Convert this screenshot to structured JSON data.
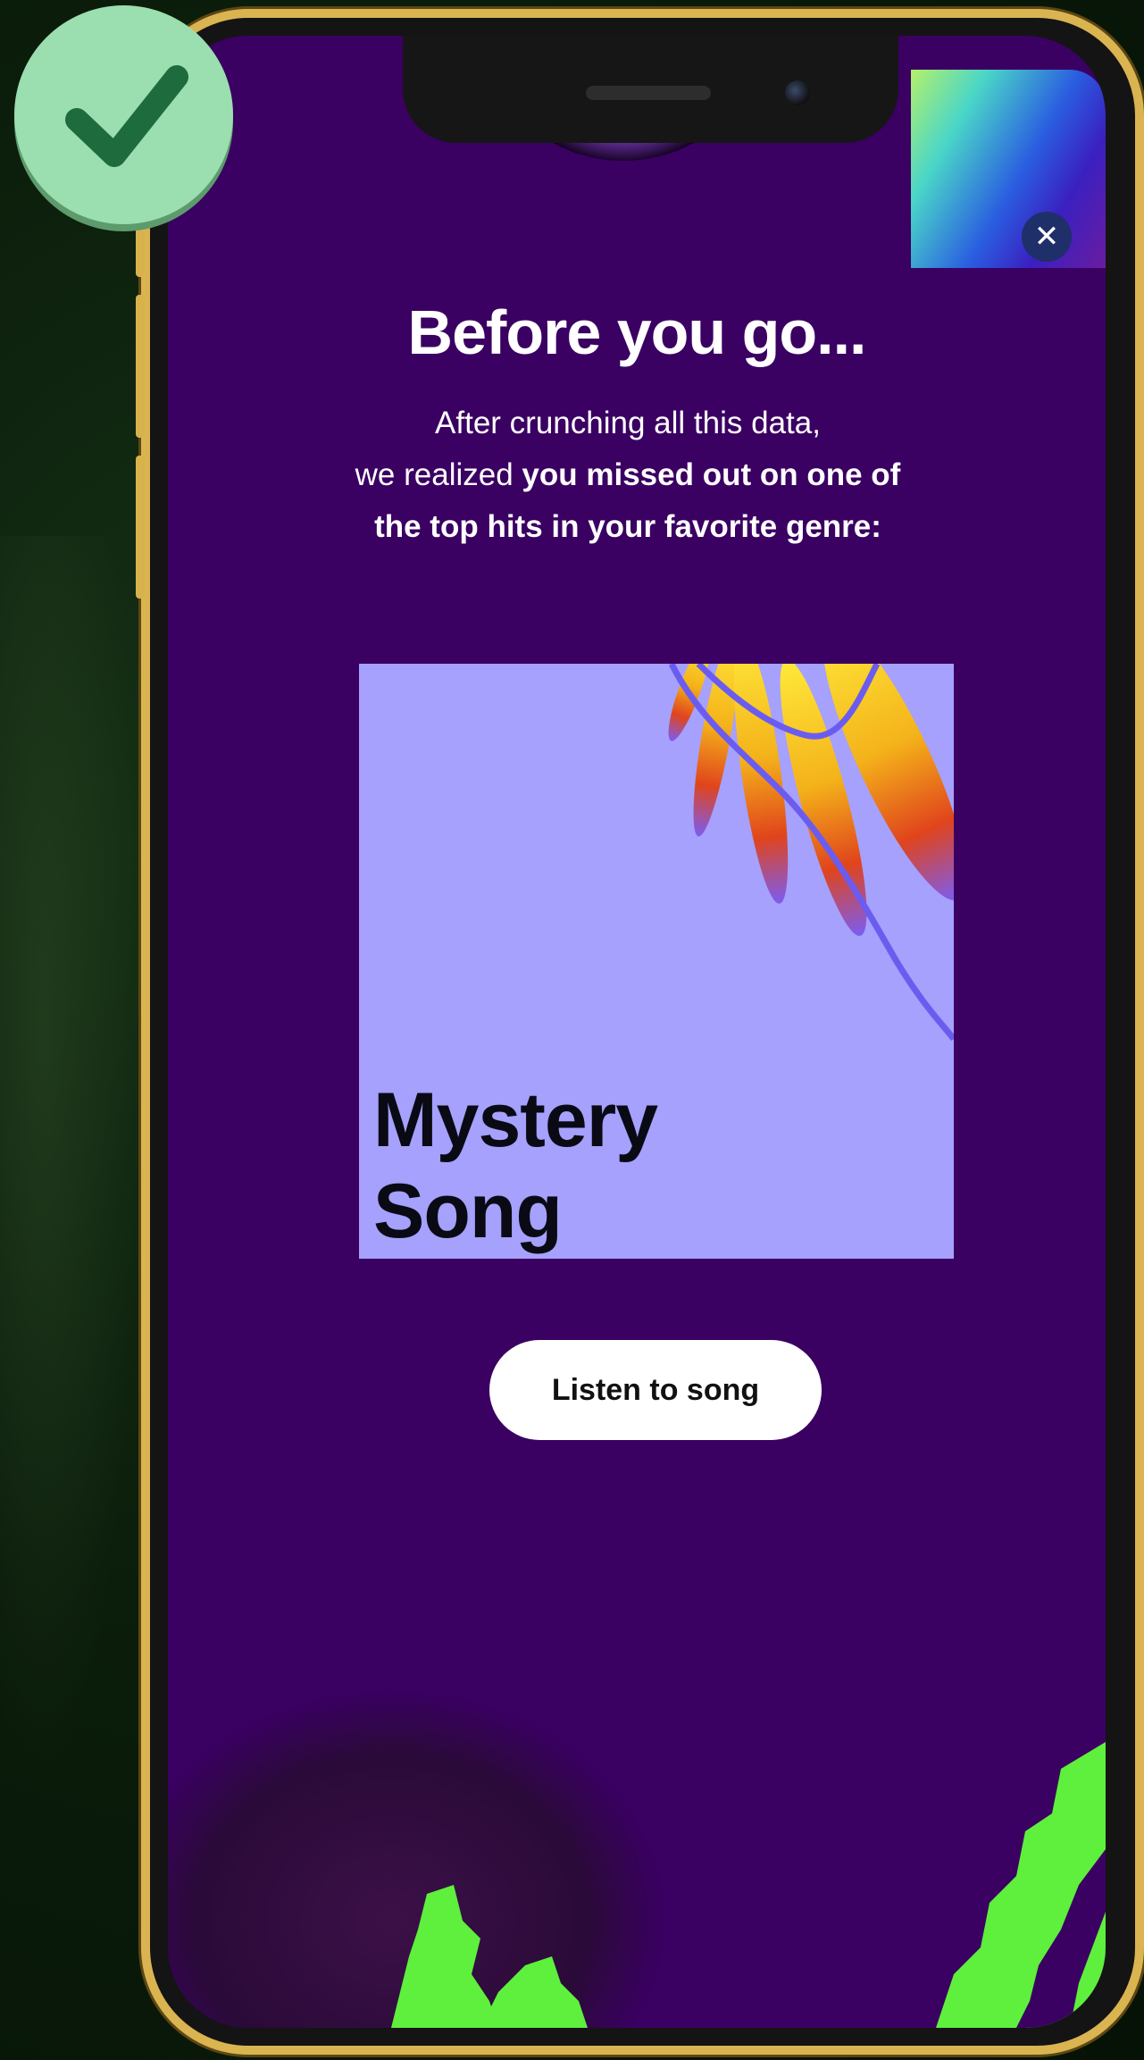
{
  "modal": {
    "title": "Before you go...",
    "body_line1": "After crunching all this data,",
    "body_line2_plain": "we realized ",
    "body_line2_bold": "you missed out on one of",
    "body_line3_bold": "the top hits in your favorite genre:",
    "close_label": "✕"
  },
  "song_card": {
    "title_line1": "Mystery",
    "title_line2": "Song"
  },
  "actions": {
    "listen_label": "Listen to song"
  },
  "badge": {
    "icon": "checkmark-icon",
    "status": "correct"
  },
  "colors": {
    "screen_bg": "#3a0062",
    "cover_bg": "#a5a1fc",
    "badge_bg": "#9bdeb0",
    "badge_check": "#1e6b3e",
    "phone_frame": "#d9b451",
    "accent_green": "#5ef03c"
  }
}
